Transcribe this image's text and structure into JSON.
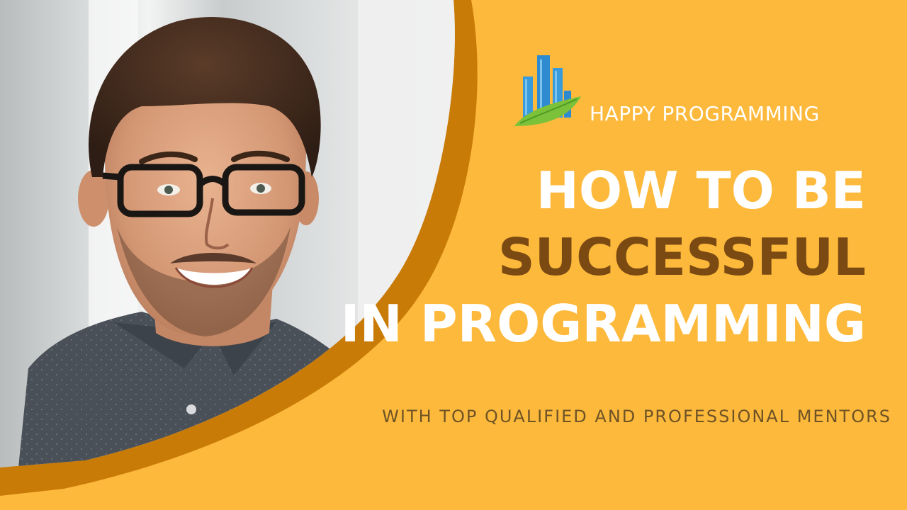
{
  "brand": {
    "name": "HAPPY PROGRAMMING",
    "logo_icon": "city-buildings-leaf-icon"
  },
  "headline": {
    "line_1": "HOW TO BE",
    "line_2": "SUCCESSFUL",
    "line_3": "IN PROGRAMMING"
  },
  "tagline": "WITH TOP QUALIFIED AND PROFESSIONAL MENTORS",
  "colors": {
    "background": "#FDB93C",
    "arc": "#C97B08",
    "headline_white": "#FFFFFF",
    "headline_brown": "#7B4A12",
    "tagline": "#6E5326",
    "logo_blue": "#3A9BDC",
    "logo_green": "#7BC23A"
  },
  "photo": {
    "subject_icon": "smiling-man-with-glasses-photo"
  }
}
